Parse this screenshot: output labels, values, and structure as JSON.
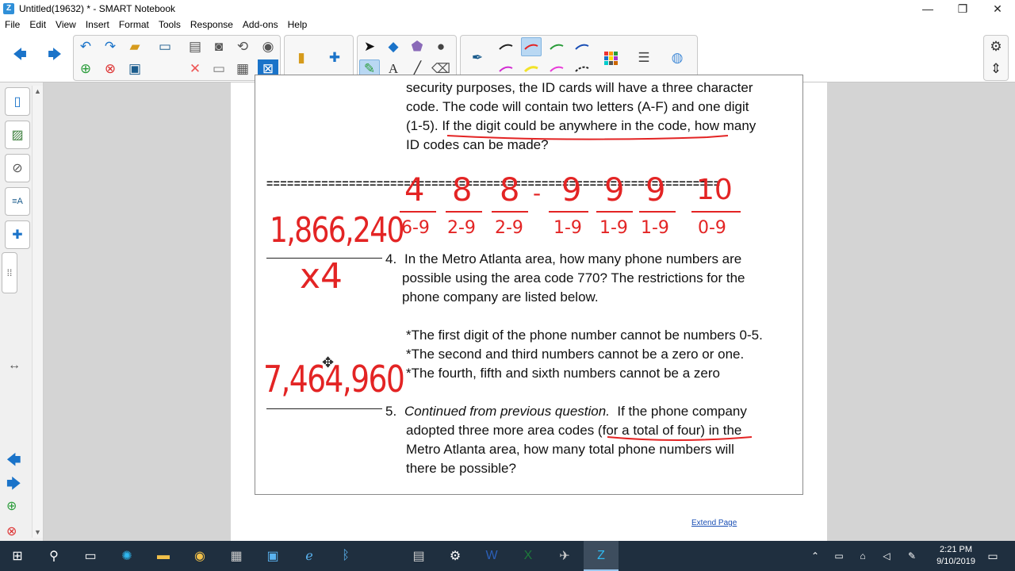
{
  "window": {
    "title": "Untitled(19632) * - SMART Notebook",
    "minimize": "—",
    "restore": "❐",
    "close": "✕"
  },
  "menu": [
    "File",
    "Edit",
    "View",
    "Insert",
    "Format",
    "Tools",
    "Response",
    "Add-ons",
    "Help"
  ],
  "document": {
    "q3_lines": [
      "security purposes, the ID cards will have a three character",
      "code.  The code will contain two letters (A-F) and one digit",
      "(1-5).  If the digit could be anywhere in the code, how many",
      "ID codes can be made?"
    ],
    "separator": "==================================================================",
    "q4_number": "4.",
    "q4_lines": [
      "In the Metro Atlanta area, how many phone numbers are",
      "possible using the area code 770?  The restrictions for the",
      "phone company are listed below."
    ],
    "restrictions": [
      "*The first digit of the phone number cannot be numbers 0-5.",
      "*The second and third numbers cannot be a zero or one.",
      "*The fourth, fifth and sixth numbers cannot be a zero"
    ],
    "q5_number": "5.",
    "q5_italic": "Continued from previous question.",
    "q5_line1_rest": "  If the phone company",
    "q5_lines": [
      "adopted three more area codes (for a total of four) in the",
      "Metro Atlanta area, how many total phone numbers will",
      "there be possible?"
    ],
    "extend_page": "Extend Page"
  },
  "ink": {
    "top_numbers": [
      "4",
      "8",
      "8",
      "-",
      "9",
      "9",
      "9",
      "10"
    ],
    "top_ranges": [
      "6-9",
      "2-9",
      "2-9",
      "",
      "1-9",
      "1-9",
      "1-9",
      "0-9"
    ],
    "left_total": "1,866,240",
    "multiplier": "x4",
    "final_total": "7,464,960"
  },
  "taskbar": {
    "time": "2:21 PM",
    "date": "9/10/2019"
  },
  "colors": {
    "ink": "#e32424",
    "taskbar": "#1f2f3f",
    "workspace": "#d4d4d4"
  }
}
